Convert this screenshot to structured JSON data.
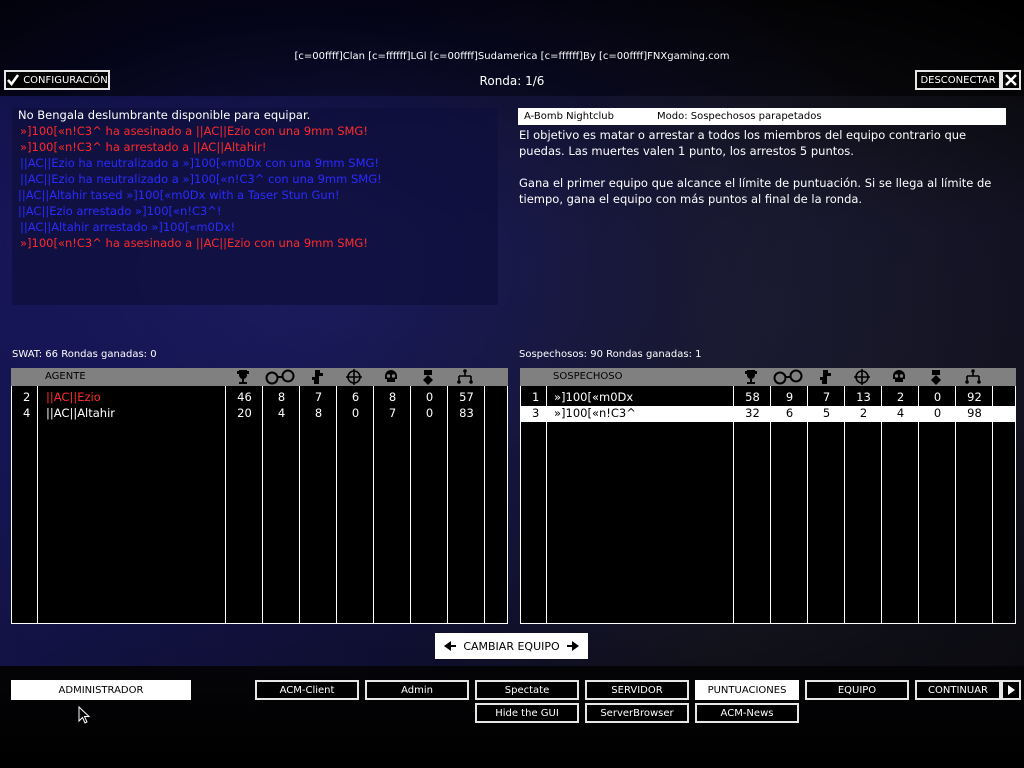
{
  "header": {
    "server_title": "[c=00ffff]Clan [c=ffffff]LGl [c=00ffff]Sudamerica [c=ffffff]By [c=00ffff]FNXgaming.com",
    "round": "Ronda: 1/6",
    "config_button": "CONFIGURACIÓN",
    "disconnect_button": "DESCONECTAR"
  },
  "chat": [
    {
      "text": "No Bengala deslumbrante disponible para equipar.",
      "color": "#ffffff"
    },
    {
      "text": "»]100[«n!C3^ ha asesinado a ||AC||Ezio con una 9mm SMG!",
      "color": "#ff2a2a"
    },
    {
      "text": "»]100[«n!C3^ ha arrestado a ||AC||Altahir!",
      "color": "#ff2a2a"
    },
    {
      "text": "||AC||Ezio ha neutralizado a »]100[«m0Dx con una 9mm SMG!",
      "color": "#2b2bff"
    },
    {
      "text": "||AC||Ezio ha neutralizado a »]100[«n!C3^ con una 9mm SMG!",
      "color": "#2b2bff"
    },
    {
      "text": "||AC||Altahir tased »]100[«m0Dx with a Taser Stun Gun!",
      "color": "#2b2bff"
    },
    {
      "text": "||AC||Ezio arrestado »]100[«n!C3^!",
      "color": "#2b2bff"
    },
    {
      "text": "||AC||Altahir arrestado »]100[«m0Dx!",
      "color": "#2b2bff"
    },
    {
      "text": "»]100[«n!C3^ ha asesinado a ||AC||Ezio con una 9mm SMG!",
      "color": "#ff2a2a"
    }
  ],
  "mission": {
    "map": "A-Bomb Nightclub",
    "mode": "Modo: Sospechosos parapetados",
    "objective": "El objetivo es matar o arrestar a todos los miembros del equipo contrario que puedas. Las muertes valen 1 punto, los arrestos 5 puntos.",
    "win": "Gana el primer equipo que alcance el límite de puntuación. Si se llega al límite de tiempo, gana el equipo con más puntos al final de la ronda."
  },
  "swat": {
    "summary": "SWAT: 66 Rondas ganadas: 0",
    "header": "AGENTE",
    "players": [
      {
        "id": "2",
        "name": "||AC||Ezio",
        "color": "#ff2a2a",
        "stats": [
          "46",
          "8",
          "7",
          "6",
          "8",
          "0",
          "57"
        ]
      },
      {
        "id": "4",
        "name": "||AC||Altahir",
        "color": "#ffffff",
        "stats": [
          "20",
          "4",
          "8",
          "0",
          "7",
          "0",
          "83"
        ]
      }
    ]
  },
  "suspects": {
    "summary": "Sospechosos: 90 Rondas ganadas: 1",
    "header": "SOSPECHOSO",
    "players": [
      {
        "id": "1",
        "name": "»]100[«m0Dx",
        "stats": [
          "58",
          "9",
          "7",
          "13",
          "2",
          "0",
          "92"
        ]
      },
      {
        "id": "3",
        "name": "»]100[«n!C3^",
        "stats": [
          "32",
          "6",
          "5",
          "2",
          "4",
          "0",
          "98"
        ]
      }
    ]
  },
  "stat_icons": [
    "trophy-icon",
    "handcuffs-icon",
    "taser-icon",
    "crosshair-icon",
    "skull-icon",
    "medal-icon",
    "ping-icon"
  ],
  "change_team": "CAMBIAR EQUIPO",
  "bottom": {
    "admin": "ADMINISTRADOR",
    "acm_client": "ACM-Client",
    "admin_btn": "Admin",
    "spectate": "Spectate",
    "servidor": "SERVIDOR",
    "puntuaciones": "PUNTUACIONES",
    "equipo": "EQUIPO",
    "continuar": "CONTINUAR",
    "hide_gui": "Hide the GUI",
    "server_browser": "ServerBrowser",
    "acm_news": "ACM-News"
  }
}
